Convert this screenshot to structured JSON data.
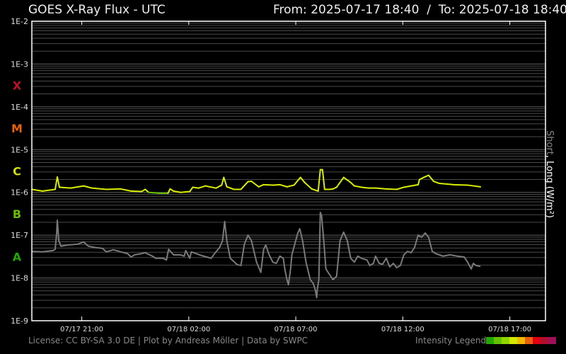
{
  "header": {
    "title": "GOES X-Ray Flux - UTC",
    "from_label": "From:",
    "from": "2025-07-17 18:40",
    "separator": "/",
    "to_label": "To:",
    "to": "2025-07-18 18:40"
  },
  "footer": {
    "license": "License: CC BY-SA 3.0 DE | Plot by Andreas Möller | Data by SWPC",
    "legend_label": "Intensity Legend",
    "legend_colors": [
      "#20a800",
      "#66c000",
      "#8fd600",
      "#d2e800",
      "#f2b800",
      "#e8600c",
      "#e00012",
      "#b0102e",
      "#a0105a"
    ]
  },
  "chart_data": {
    "type": "line",
    "title": "GOES X-Ray Flux - UTC",
    "ylabel_short": "Short",
    "ylabel_long": ", Long (W/m²)",
    "yscale": "log",
    "ylim": [
      1e-09,
      0.01
    ],
    "xlim_hours": [
      0,
      24
    ],
    "x_unit": "hours since 2025-07-17 18:40 UTC",
    "grid": true,
    "y_ticks": [
      "1E-2",
      "1E-3",
      "1E-4",
      "1E-5",
      "1E-6",
      "1E-7",
      "1E-8",
      "1E-9"
    ],
    "x_ticks": [
      {
        "label": "07/17 21:00",
        "h": 2.333
      },
      {
        "label": "07/18 02:00",
        "h": 7.333
      },
      {
        "label": "07/18 07:00",
        "h": 12.333
      },
      {
        "label": "07/18 12:00",
        "h": 17.333
      },
      {
        "label": "07/18 17:00",
        "h": 22.333
      }
    ],
    "classes": [
      {
        "label": "X",
        "log": -3.5,
        "color": "#c0102a"
      },
      {
        "label": "M",
        "log": -4.5,
        "color": "#e8600c"
      },
      {
        "label": "C",
        "log": -5.5,
        "color": "#d4e000"
      },
      {
        "label": "B",
        "log": -6.5,
        "color": "#66c000"
      },
      {
        "label": "A",
        "log": -7.5,
        "color": "#20a800"
      }
    ],
    "series": [
      {
        "name": "Long",
        "color": "#d8ee00",
        "below_c_color": "#66c000",
        "points_log10": [
          [
            0,
            -5.93
          ],
          [
            0.5,
            -5.97
          ],
          [
            1.09,
            -5.93
          ],
          [
            1.19,
            -5.64
          ],
          [
            1.29,
            -5.88
          ],
          [
            1.82,
            -5.9
          ],
          [
            2.42,
            -5.85
          ],
          [
            2.81,
            -5.9
          ],
          [
            3.48,
            -5.93
          ],
          [
            4.14,
            -5.92
          ],
          [
            4.64,
            -5.97
          ],
          [
            5.13,
            -5.98
          ],
          [
            5.3,
            -5.93
          ],
          [
            5.46,
            -6.0
          ],
          [
            5.96,
            -6.02
          ],
          [
            6.36,
            -6.02
          ],
          [
            6.46,
            -5.92
          ],
          [
            6.62,
            -5.97
          ],
          [
            6.95,
            -6.0
          ],
          [
            7.38,
            -5.98
          ],
          [
            7.52,
            -5.88
          ],
          [
            7.78,
            -5.9
          ],
          [
            8.11,
            -5.85
          ],
          [
            8.61,
            -5.9
          ],
          [
            8.87,
            -5.83
          ],
          [
            8.97,
            -5.65
          ],
          [
            9.11,
            -5.87
          ],
          [
            9.44,
            -5.93
          ],
          [
            9.77,
            -5.93
          ],
          [
            10.1,
            -5.75
          ],
          [
            10.26,
            -5.74
          ],
          [
            10.6,
            -5.87
          ],
          [
            10.83,
            -5.82
          ],
          [
            11.26,
            -5.83
          ],
          [
            11.59,
            -5.82
          ],
          [
            11.92,
            -5.87
          ],
          [
            12.25,
            -5.83
          ],
          [
            12.55,
            -5.65
          ],
          [
            12.75,
            -5.77
          ],
          [
            13.08,
            -5.92
          ],
          [
            13.38,
            -5.97
          ],
          [
            13.48,
            -5.47
          ],
          [
            13.58,
            -5.47
          ],
          [
            13.68,
            -5.93
          ],
          [
            13.91,
            -5.93
          ],
          [
            14.07,
            -5.92
          ],
          [
            14.24,
            -5.88
          ],
          [
            14.57,
            -5.65
          ],
          [
            14.9,
            -5.77
          ],
          [
            15.07,
            -5.85
          ],
          [
            15.4,
            -5.88
          ],
          [
            15.73,
            -5.9
          ],
          [
            16.06,
            -5.9
          ],
          [
            16.56,
            -5.92
          ],
          [
            17.05,
            -5.93
          ],
          [
            17.38,
            -5.88
          ],
          [
            17.72,
            -5.85
          ],
          [
            18.05,
            -5.82
          ],
          [
            18.11,
            -5.7
          ],
          [
            18.31,
            -5.65
          ],
          [
            18.54,
            -5.6
          ],
          [
            18.77,
            -5.74
          ],
          [
            19.04,
            -5.79
          ],
          [
            19.7,
            -5.82
          ],
          [
            20.36,
            -5.83
          ],
          [
            20.96,
            -5.87
          ]
        ]
      },
      {
        "name": "Short",
        "color": "#7a7a7a",
        "points_log10": [
          [
            0,
            -7.38
          ],
          [
            0.5,
            -7.39
          ],
          [
            0.99,
            -7.36
          ],
          [
            1.09,
            -7.33
          ],
          [
            1.16,
            -6.96
          ],
          [
            1.19,
            -6.65
          ],
          [
            1.26,
            -7.13
          ],
          [
            1.36,
            -7.26
          ],
          [
            1.66,
            -7.23
          ],
          [
            2.15,
            -7.21
          ],
          [
            2.42,
            -7.16
          ],
          [
            2.65,
            -7.26
          ],
          [
            2.98,
            -7.29
          ],
          [
            3.31,
            -7.31
          ],
          [
            3.48,
            -7.39
          ],
          [
            3.81,
            -7.34
          ],
          [
            4.14,
            -7.39
          ],
          [
            4.47,
            -7.43
          ],
          [
            4.64,
            -7.51
          ],
          [
            4.8,
            -7.46
          ],
          [
            5.13,
            -7.43
          ],
          [
            5.3,
            -7.41
          ],
          [
            5.63,
            -7.49
          ],
          [
            5.79,
            -7.54
          ],
          [
            6.13,
            -7.54
          ],
          [
            6.29,
            -7.58
          ],
          [
            6.39,
            -7.33
          ],
          [
            6.62,
            -7.46
          ],
          [
            6.95,
            -7.46
          ],
          [
            7.12,
            -7.49
          ],
          [
            7.19,
            -7.36
          ],
          [
            7.38,
            -7.54
          ],
          [
            7.45,
            -7.39
          ],
          [
            7.95,
            -7.48
          ],
          [
            8.38,
            -7.54
          ],
          [
            8.54,
            -7.43
          ],
          [
            8.77,
            -7.29
          ],
          [
            8.91,
            -7.13
          ],
          [
            9.01,
            -6.68
          ],
          [
            9.11,
            -7.13
          ],
          [
            9.27,
            -7.54
          ],
          [
            9.6,
            -7.69
          ],
          [
            9.77,
            -7.71
          ],
          [
            9.93,
            -7.21
          ],
          [
            10.1,
            -7.0
          ],
          [
            10.26,
            -7.13
          ],
          [
            10.5,
            -7.63
          ],
          [
            10.7,
            -7.87
          ],
          [
            10.83,
            -7.33
          ],
          [
            10.93,
            -7.23
          ],
          [
            11.09,
            -7.46
          ],
          [
            11.26,
            -7.63
          ],
          [
            11.42,
            -7.66
          ],
          [
            11.59,
            -7.49
          ],
          [
            11.75,
            -7.54
          ],
          [
            11.82,
            -7.79
          ],
          [
            11.92,
            -8.04
          ],
          [
            11.99,
            -8.16
          ],
          [
            12.09,
            -7.79
          ],
          [
            12.15,
            -7.46
          ],
          [
            12.42,
            -6.96
          ],
          [
            12.52,
            -6.85
          ],
          [
            12.65,
            -7.13
          ],
          [
            12.81,
            -7.63
          ],
          [
            13.01,
            -8.04
          ],
          [
            13.15,
            -8.13
          ],
          [
            13.25,
            -8.29
          ],
          [
            13.31,
            -8.46
          ],
          [
            13.34,
            -8.26
          ],
          [
            13.41,
            -8.04
          ],
          [
            13.48,
            -6.47
          ],
          [
            13.54,
            -6.55
          ],
          [
            13.64,
            -7.13
          ],
          [
            13.74,
            -7.79
          ],
          [
            13.91,
            -7.92
          ],
          [
            14.07,
            -8.04
          ],
          [
            14.24,
            -7.96
          ],
          [
            14.4,
            -7.13
          ],
          [
            14.57,
            -6.93
          ],
          [
            14.74,
            -7.13
          ],
          [
            14.9,
            -7.54
          ],
          [
            15.07,
            -7.63
          ],
          [
            15.23,
            -7.49
          ],
          [
            15.4,
            -7.54
          ],
          [
            15.66,
            -7.58
          ],
          [
            15.79,
            -7.71
          ],
          [
            15.96,
            -7.66
          ],
          [
            16.06,
            -7.49
          ],
          [
            16.23,
            -7.66
          ],
          [
            16.39,
            -7.68
          ],
          [
            16.56,
            -7.54
          ],
          [
            16.72,
            -7.74
          ],
          [
            16.89,
            -7.66
          ],
          [
            17.05,
            -7.76
          ],
          [
            17.22,
            -7.71
          ],
          [
            17.38,
            -7.46
          ],
          [
            17.55,
            -7.38
          ],
          [
            17.72,
            -7.41
          ],
          [
            17.88,
            -7.29
          ],
          [
            18.05,
            -7.0
          ],
          [
            18.21,
            -7.05
          ],
          [
            18.38,
            -6.95
          ],
          [
            18.54,
            -7.05
          ],
          [
            18.71,
            -7.38
          ],
          [
            18.87,
            -7.43
          ],
          [
            19.21,
            -7.49
          ],
          [
            19.54,
            -7.46
          ],
          [
            19.87,
            -7.49
          ],
          [
            20.2,
            -7.51
          ],
          [
            20.36,
            -7.63
          ],
          [
            20.53,
            -7.79
          ],
          [
            20.63,
            -7.66
          ],
          [
            20.76,
            -7.71
          ],
          [
            20.96,
            -7.73
          ]
        ]
      }
    ]
  }
}
